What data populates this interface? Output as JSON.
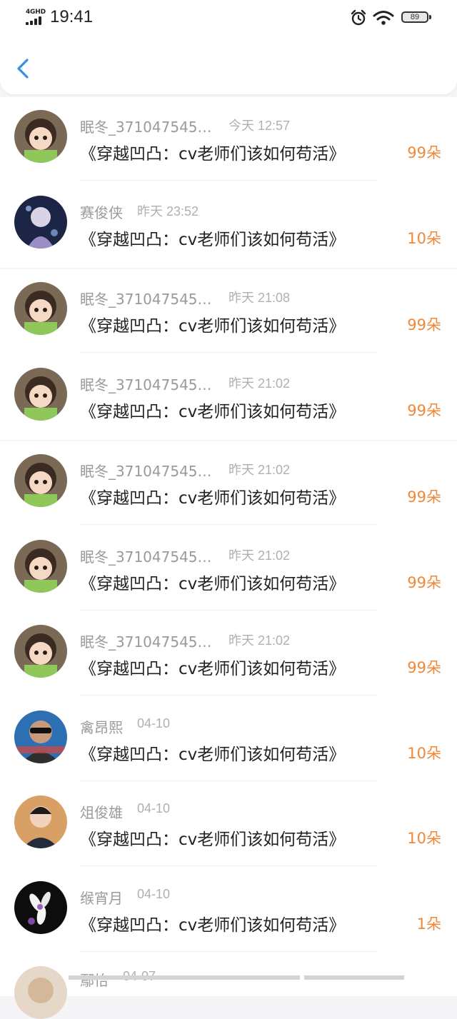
{
  "status_bar": {
    "network": "4GHD",
    "time": "19:41",
    "battery": "89"
  },
  "nav": {
    "back_icon": "chevron-left-icon",
    "accent_color": "#3a8ee6"
  },
  "colors": {
    "count": "#f0883a",
    "name": "#9a9a9a",
    "title": "#222222"
  },
  "items": [
    {
      "name": "眠冬_371047545…",
      "time": "今天 12:57",
      "title": "《穿越凹凸：cv老师们该如何苟活》",
      "count": "99朵",
      "avatar": "girl-avatar"
    },
    {
      "name": "赛俊侠",
      "time": "昨天 23:52",
      "title": "《穿越凹凸：cv老师们该如何苟活》",
      "count": "10朵",
      "avatar": "anime-avatar"
    },
    {
      "name": "眠冬_371047545…",
      "time": "昨天 21:08",
      "title": "《穿越凹凸：cv老师们该如何苟活》",
      "count": "99朵",
      "avatar": "girl-avatar"
    },
    {
      "name": "眠冬_371047545…",
      "time": "昨天 21:02",
      "title": "《穿越凹凸：cv老师们该如何苟活》",
      "count": "99朵",
      "avatar": "girl-avatar"
    },
    {
      "name": "眠冬_371047545…",
      "time": "昨天 21:02",
      "title": "《穿越凹凸：cv老师们该如何苟活》",
      "count": "99朵",
      "avatar": "girl-avatar"
    },
    {
      "name": "眠冬_371047545…",
      "time": "昨天 21:02",
      "title": "《穿越凹凸：cv老师们该如何苟活》",
      "count": "99朵",
      "avatar": "girl-avatar"
    },
    {
      "name": "眠冬_371047545…",
      "time": "昨天 21:02",
      "title": "《穿越凹凸：cv老师们该如何苟活》",
      "count": "99朵",
      "avatar": "girl-avatar"
    },
    {
      "name": "禽昂熙",
      "time": "04-10",
      "title": "《穿越凹凸：cv老师们该如何苟活》",
      "count": "10朵",
      "avatar": "man-avatar"
    },
    {
      "name": "俎俊雄",
      "time": "04-10",
      "title": "《穿越凹凸：cv老师们该如何苟活》",
      "count": "10朵",
      "avatar": "boy-avatar"
    },
    {
      "name": "缑宵月",
      "time": "04-10",
      "title": "《穿越凹凸：cv老师们该如何苟活》",
      "count": "1朵",
      "avatar": "flower-avatar"
    }
  ],
  "partial_item": {
    "name": "鄢怡",
    "time": "04-07"
  }
}
